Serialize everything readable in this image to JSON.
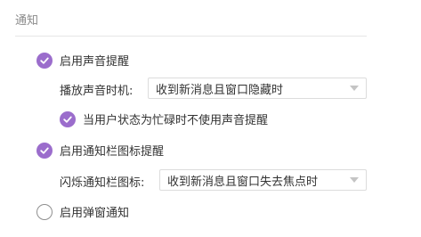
{
  "section": {
    "title": "通知"
  },
  "settings": {
    "sound": {
      "label": "启用声音提醒",
      "checked": true
    },
    "sound_timing": {
      "label": "播放声音时机:",
      "value": "收到新消息且窗口隐藏时"
    },
    "busy_mute": {
      "label": "当用户状态为忙碌时不使用声音提醒",
      "checked": true
    },
    "tray": {
      "label": "启用通知栏图标提醒",
      "checked": true
    },
    "tray_flash": {
      "label": "闪烁通知栏图标:",
      "value": "收到新消息且窗口失去焦点时"
    },
    "popup": {
      "label": "启用弹窗通知",
      "checked": false
    }
  },
  "colors": {
    "accent": "#9b6dcc"
  }
}
